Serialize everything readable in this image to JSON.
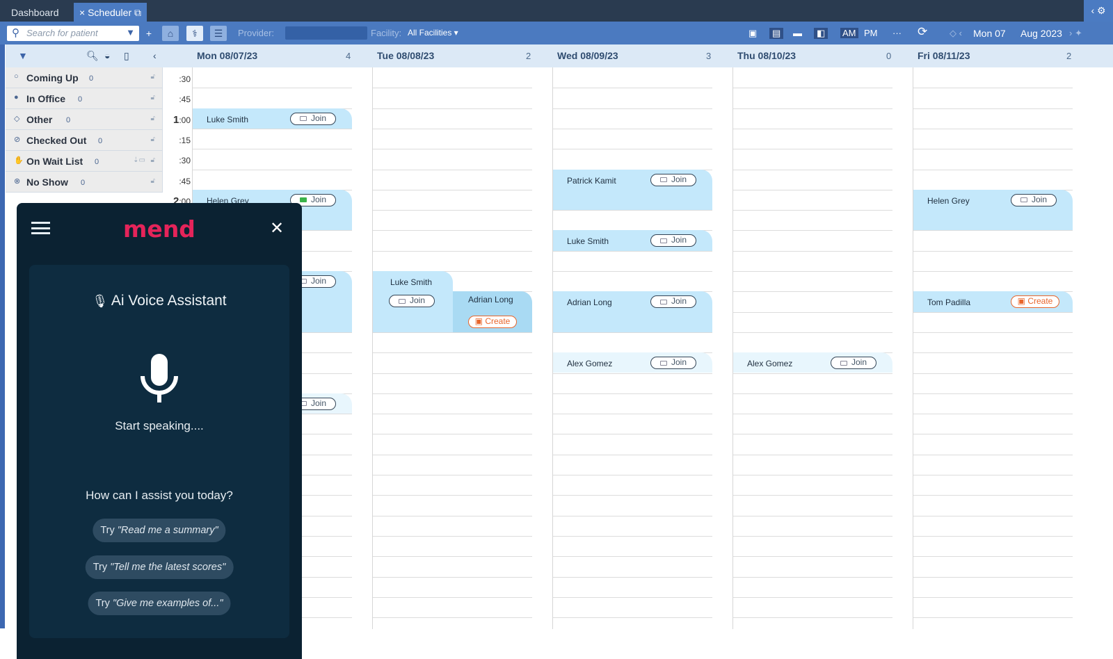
{
  "tabs": [
    {
      "label": "Dashboard"
    },
    {
      "label": "Scheduler",
      "close": "×"
    }
  ],
  "toolbar": {
    "search_placeholder": "Search for patient",
    "provider_label": "Provider:",
    "provider_value": "",
    "facility_label": "Facility:",
    "facility_value": "All Facilities ▾",
    "am": "AM",
    "pm": "PM",
    "more": "···",
    "date_day": "Mon 07",
    "date_month": "Aug 2023"
  },
  "days": [
    {
      "label": "Mon 08/07/23",
      "count": "4"
    },
    {
      "label": "Tue 08/08/23",
      "count": "2"
    },
    {
      "label": "Wed 08/09/23",
      "count": "3"
    },
    {
      "label": "Thu 08/10/23",
      "count": "0"
    },
    {
      "label": "Fri 08/11/23",
      "count": "2"
    }
  ],
  "statuses": [
    {
      "icon": "○",
      "label": "Coming Up",
      "count": "0"
    },
    {
      "icon": "●",
      "label": "In Office",
      "count": "0"
    },
    {
      "icon": "◇",
      "label": "Other",
      "count": "0"
    },
    {
      "icon": "⊘",
      "label": "Checked Out",
      "count": "0"
    },
    {
      "icon": "✋",
      "label": "On Wait List",
      "count": "0"
    },
    {
      "icon": "⊗",
      "label": "No Show",
      "count": "0"
    }
  ],
  "times": [
    {
      "h": "",
      "m": ":30"
    },
    {
      "h": "",
      "m": ":45"
    },
    {
      "h": "1",
      "m": ":00"
    },
    {
      "h": "",
      "m": ":15"
    },
    {
      "h": "",
      "m": ":30"
    },
    {
      "h": "",
      "m": ":45"
    },
    {
      "h": "2",
      "m": ":00"
    }
  ],
  "appointments": [
    {
      "day": 0,
      "slot": 2,
      "span": 1,
      "name": "Luke Smith",
      "action": "Join"
    },
    {
      "day": 0,
      "slot": 6,
      "span": 2,
      "name": "Helen Grey",
      "action": "Join",
      "live": true
    },
    {
      "day": 0,
      "slot": 10,
      "span": 3,
      "name": "",
      "action": "Join"
    },
    {
      "day": 0,
      "slot": 16,
      "span": 1,
      "name": "",
      "action": "Join",
      "light": true
    },
    {
      "day": 1,
      "slot": 10,
      "span": 3,
      "name": "Luke Smith",
      "action": "Join",
      "half": "left"
    },
    {
      "day": 1,
      "slot": 11,
      "span": 2,
      "name": "Adrian Long",
      "action": "Create",
      "half": "right"
    },
    {
      "day": 2,
      "slot": 5,
      "span": 2,
      "name": "Patrick Kamit",
      "action": "Join"
    },
    {
      "day": 2,
      "slot": 8,
      "span": 1,
      "name": "Luke Smith",
      "action": "Join"
    },
    {
      "day": 2,
      "slot": 11,
      "span": 2,
      "name": "Adrian Long",
      "action": "Join"
    },
    {
      "day": 2,
      "slot": 14,
      "span": 1,
      "name": "Alex Gomez",
      "action": "Join",
      "light": true
    },
    {
      "day": 3,
      "slot": 14,
      "span": 1,
      "name": "Alex Gomez",
      "action": "Join",
      "light": true
    },
    {
      "day": 4,
      "slot": 6,
      "span": 2,
      "name": "Helen Grey",
      "action": "Join"
    },
    {
      "day": 4,
      "slot": 11,
      "span": 1,
      "name": "Tom Padilla",
      "action": "Create"
    }
  ],
  "assistant": {
    "logo": "mend",
    "title": "Ai Voice Assistant",
    "status": "Start speaking....",
    "prompt": "How can I assist you today?",
    "suggestions": [
      {
        "pre": "Try ",
        "text": "\"Read me a summary\""
      },
      {
        "pre": "Try ",
        "text": "\"Tell me the latest scores\""
      },
      {
        "pre": "Try ",
        "text": "\"Give me examples of...\""
      }
    ]
  },
  "colors": {
    "brand": "#e5245a",
    "toolbar": "#4b7ac0",
    "appointment": "#c4e8fb",
    "create": "#e8652b"
  }
}
